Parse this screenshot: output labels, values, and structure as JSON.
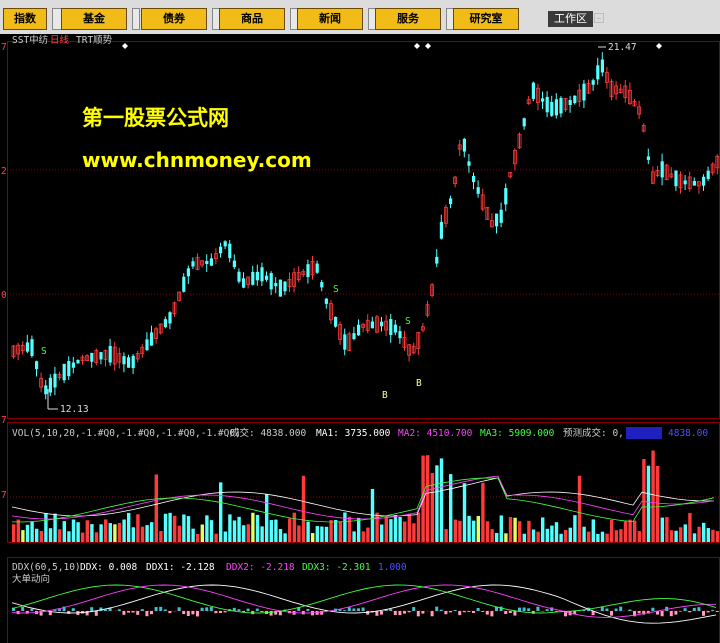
{
  "toolbar": {
    "buttons": [
      "指数",
      "基金",
      "债券",
      "商品",
      "新闻",
      "服务",
      "研究室"
    ],
    "workspace": "工作区"
  },
  "main_chart": {
    "header": "SST中纺",
    "period": "日线",
    "indicator": "TRT顺势",
    "axis_labels": [
      "7",
      "2",
      "0",
      "7"
    ],
    "high_label": "21.47",
    "low_label": "12.13",
    "signals": [
      "S",
      "S",
      "S",
      "B",
      "B"
    ],
    "watermark_title": "第一股票公式网",
    "watermark_url": "www.chnmoney.com"
  },
  "volume": {
    "label": "VOL(5,10,20,-1.#Q0,-1.#Q0,-1.#Q0,-1.#Q0)",
    "cjl": "成交: 4838.000",
    "ma1": "MA1: 3735.000",
    "ma2": "MA2: 4510.700",
    "ma3": "MA3: 5909.000",
    "forecast": "预测成交: 0,",
    "tail": "4838.00",
    "axis_label": "7"
  },
  "ddx": {
    "label": "DDX(60,5,10)",
    "ddx": "DDX: 0.008",
    "ddx1": "DDX1: -2.128",
    "ddx2": "DDX2: -2.218",
    "ddx3": "DDX3: -2.301",
    "extra": "1.000",
    "sub": "大单动向"
  },
  "colors": {
    "up": "#ff3a3a",
    "down": "#54ffff",
    "grid": "#8a0000",
    "ma1": "#ffffff",
    "ma2": "#ff40ff",
    "ma3": "#40ff40",
    "watermark": "#ffff00"
  }
}
